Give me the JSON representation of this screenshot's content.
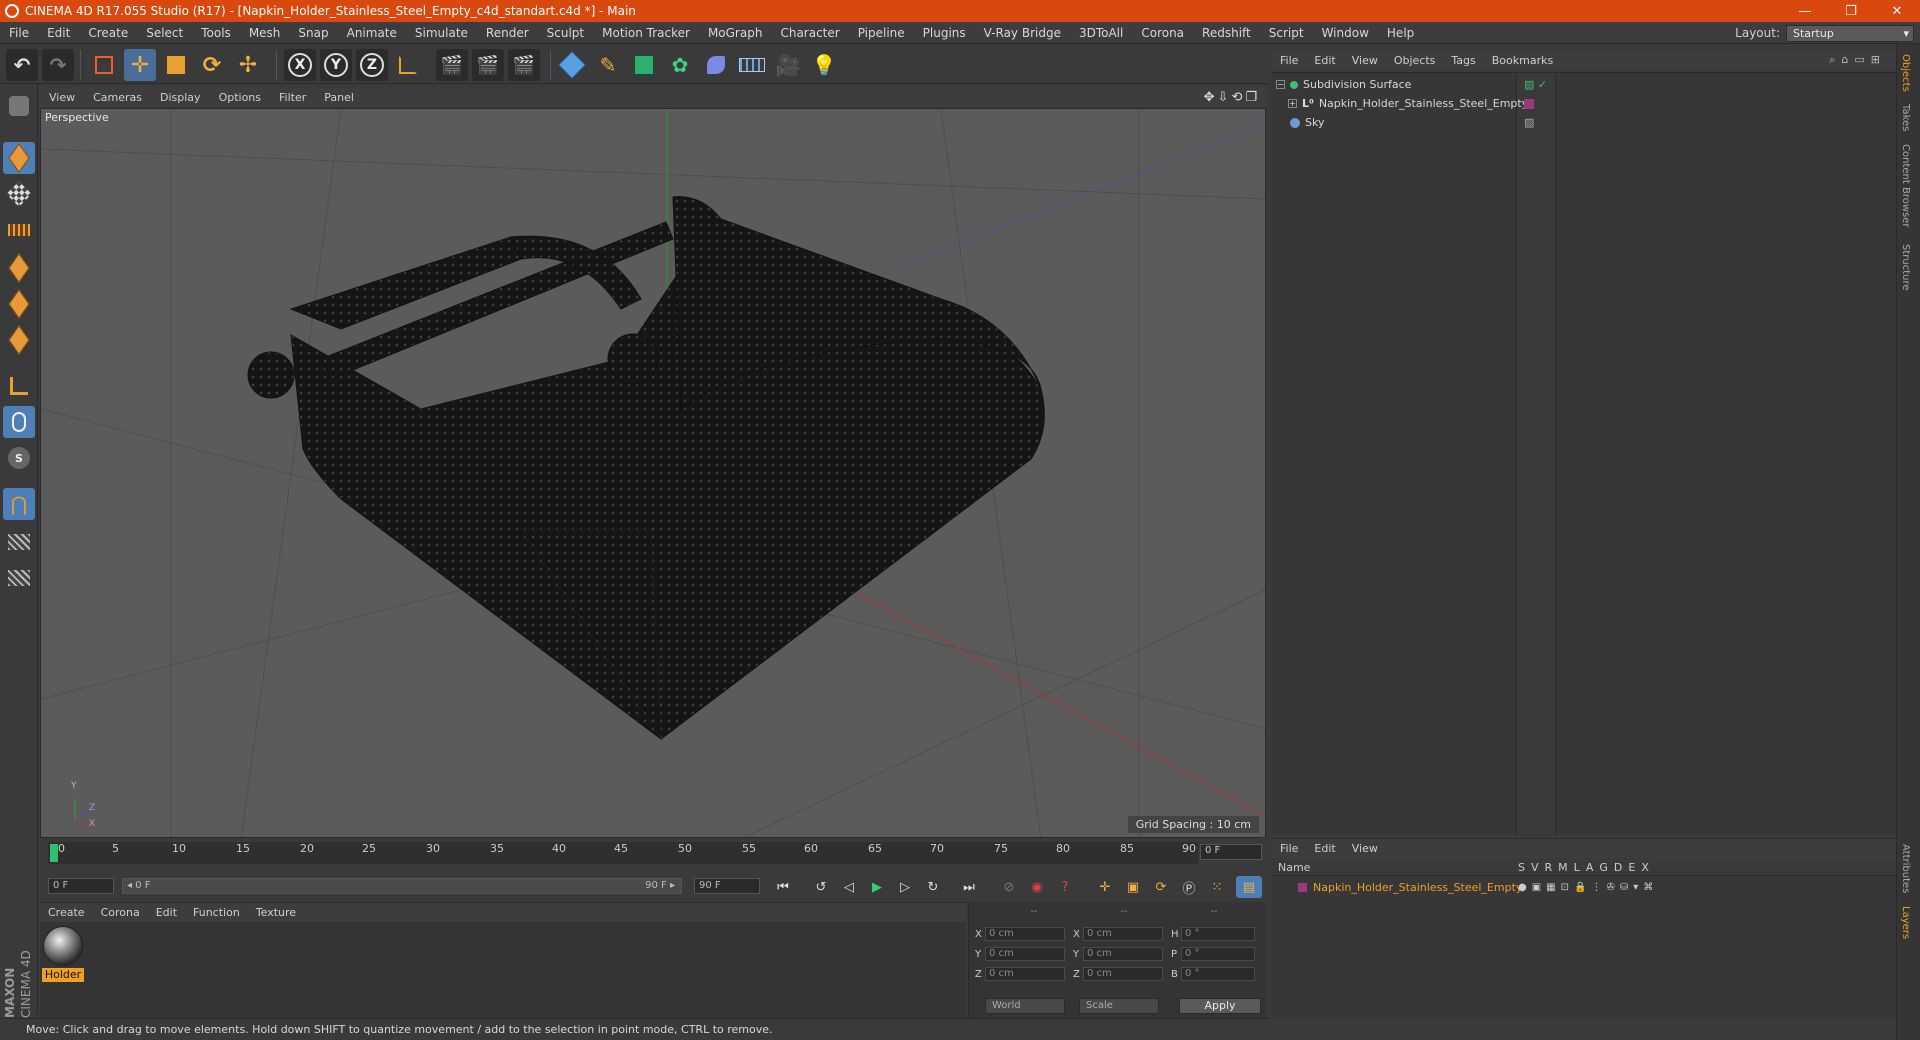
{
  "window": {
    "title": "CINEMA 4D R17.055 Studio (R17) - [Napkin_Holder_Stainless_Steel_Empty_c4d_standart.c4d *] - Main",
    "controls": [
      "—",
      "❐",
      "✕"
    ]
  },
  "menubar": {
    "items": [
      "File",
      "Edit",
      "Create",
      "Select",
      "Tools",
      "Mesh",
      "Snap",
      "Animate",
      "Simulate",
      "Render",
      "Sculpt",
      "Motion Tracker",
      "MoGraph",
      "Character",
      "Pipeline",
      "Plugins",
      "V-Ray Bridge",
      "3DToAll",
      "Corona",
      "Redshift",
      "Script",
      "Window",
      "Help"
    ],
    "layout_label": "Layout:",
    "layout_value": "Startup"
  },
  "toolbar": {
    "axis_x": "X",
    "axis_y": "Y",
    "axis_z": "Z"
  },
  "viewport": {
    "menu": [
      "View",
      "Cameras",
      "Display",
      "Options",
      "Filter",
      "Panel"
    ],
    "label": "Perspective",
    "grid_spacing": "Grid Spacing : 10 cm",
    "axis_labels": {
      "y": "Y",
      "z": "Z",
      "x": "X"
    }
  },
  "timeline": {
    "ticks": [
      "0",
      "5",
      "10",
      "15",
      "20",
      "25",
      "30",
      "35",
      "40",
      "45",
      "50",
      "55",
      "60",
      "65",
      "70",
      "75",
      "80",
      "85",
      "90"
    ],
    "current_frame": "0 F",
    "start_field": "0 F",
    "range_start": "◂ 0 F",
    "range_end": "90 F ▸",
    "end_field": "90 F"
  },
  "materials": {
    "menu": [
      "Create",
      "Corona",
      "Edit",
      "Function",
      "Texture"
    ],
    "items": [
      {
        "label": "Holder"
      }
    ]
  },
  "brand": {
    "line1": "MAXON",
    "line2": "CINEMA 4D"
  },
  "coordinates": {
    "headers": [
      "--",
      "--",
      "--"
    ],
    "rows": [
      {
        "l1": "X",
        "v1": "0 cm",
        "l2": "X",
        "v2": "0 cm",
        "l3": "H",
        "v3": "0 °"
      },
      {
        "l1": "Y",
        "v1": "0 cm",
        "l2": "Y",
        "v2": "0 cm",
        "l3": "P",
        "v3": "0 °"
      },
      {
        "l1": "Z",
        "v1": "0 cm",
        "l2": "Z",
        "v2": "0 cm",
        "l3": "B",
        "v3": "0 °"
      }
    ],
    "mode1": "World",
    "mode2": "Scale",
    "apply_label": "Apply"
  },
  "status": {
    "text": "Move: Click and drag to move elements. Hold down SHIFT to quantize movement / add to the selection in point mode, CTRL to remove."
  },
  "objects": {
    "menu": [
      "File",
      "Edit",
      "View",
      "Objects",
      "Tags",
      "Bookmarks"
    ],
    "items": [
      {
        "name": "Subdivision Surface",
        "icon_color": "#3fbf6f"
      },
      {
        "name": "Napkin_Holder_Stainless_Steel_Empty",
        "icon_color": "#c8c8c8"
      },
      {
        "name": "Sky",
        "icon_color": "#6a9bd8"
      }
    ]
  },
  "layers": {
    "menu": [
      "File",
      "Edit",
      "View"
    ],
    "header_name": "Name",
    "header_cols": [
      "S",
      "V",
      "R",
      "M",
      "L",
      "A",
      "G",
      "D",
      "E",
      "X"
    ],
    "items": [
      {
        "name": "Napkin_Holder_Stainless_Steel_Empty",
        "color": "#9b3a7a"
      }
    ]
  },
  "right_tabs": [
    "Objects",
    "Takes",
    "Content Browser",
    "Structure",
    "Attributes",
    "Layers"
  ],
  "colors": {
    "titlebar": "#d9480f",
    "accent": "#f0a020",
    "tool_active": "#4e7fb7"
  }
}
